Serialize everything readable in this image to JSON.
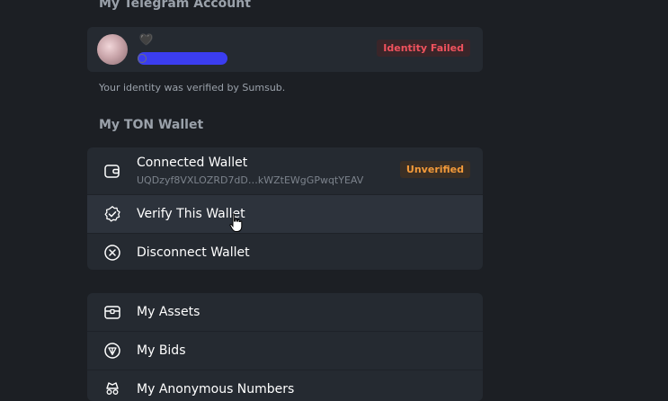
{
  "telegram": {
    "section_title": "My Telegram Account",
    "badge": "Identity Failed",
    "note": "Your identity was verified by Sumsub."
  },
  "wallet": {
    "section_title": "My TON Wallet",
    "connected_label": "Connected Wallet",
    "address": "UQDzyf8VXLOZRD7dD…kWZtEWgGPwqtYEAV",
    "badge": "Unverified",
    "verify_label": "Verify This Wallet",
    "disconnect_label": "Disconnect Wallet"
  },
  "menu": {
    "assets_label": "My Assets",
    "bids_label": "My Bids",
    "numbers_label": "My Anonymous Numbers"
  },
  "colors": {
    "background": "#1c1f24",
    "card": "#252a31",
    "danger": "#f0525e",
    "warning": "#f39a3a",
    "redaction": "#3b3df0"
  },
  "icons": [
    "wallet-icon",
    "check-badge-icon",
    "close-circle-icon",
    "chest-icon",
    "ton-triangle-icon",
    "anonymous-icon",
    "pointer-cursor-icon"
  ]
}
